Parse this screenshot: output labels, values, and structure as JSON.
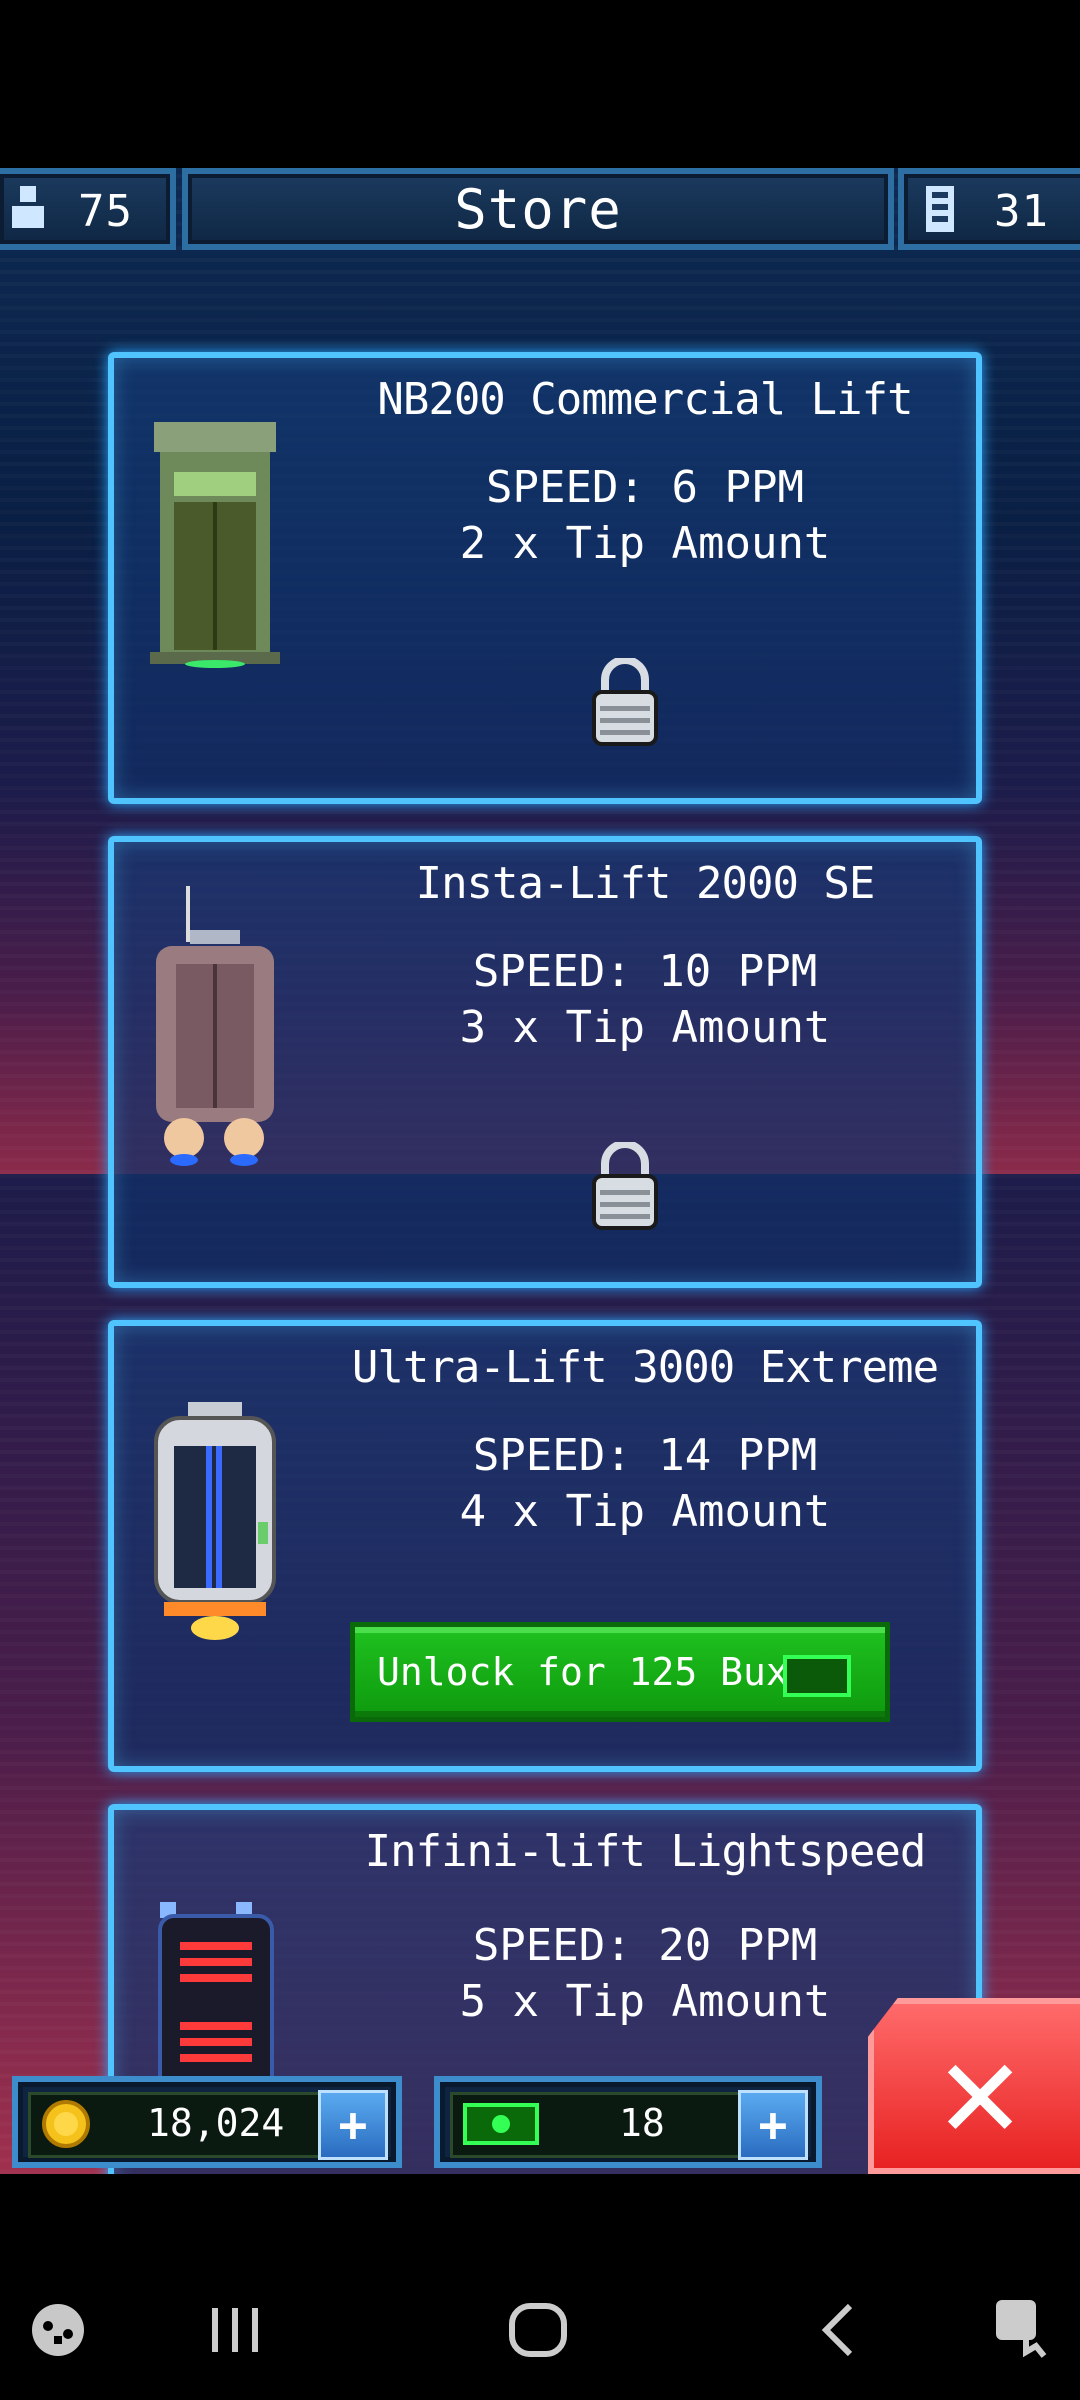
{
  "header": {
    "people_count": "75",
    "title": "Store",
    "floors_count": "31"
  },
  "lifts": [
    {
      "name": "NB200 Commercial Lift",
      "speed": "SPEED: 6 PPM",
      "tip": "2 x Tip Amount",
      "state": "locked"
    },
    {
      "name": "Insta-Lift 2000 SE",
      "speed": "SPEED: 10 PPM",
      "tip": "3 x Tip Amount",
      "state": "locked"
    },
    {
      "name": "Ultra-Lift 3000 Extreme",
      "speed": "SPEED: 14 PPM",
      "tip": "4 x Tip Amount",
      "state": "unlockable",
      "unlock_label": "Unlock for 125 Bux?"
    },
    {
      "name": "Infini-lift Lightspeed",
      "speed": "SPEED: 20 PPM",
      "tip": "5 x Tip Amount",
      "state": "partial"
    }
  ],
  "currency": {
    "coins": "18,024",
    "bux": "18",
    "plus_label": "+"
  },
  "close_label": "✕",
  "colors": {
    "accent": "#4fc4ff",
    "unlock": "#1fc21f",
    "close": "#e82222",
    "coin": "#f5c21b"
  }
}
